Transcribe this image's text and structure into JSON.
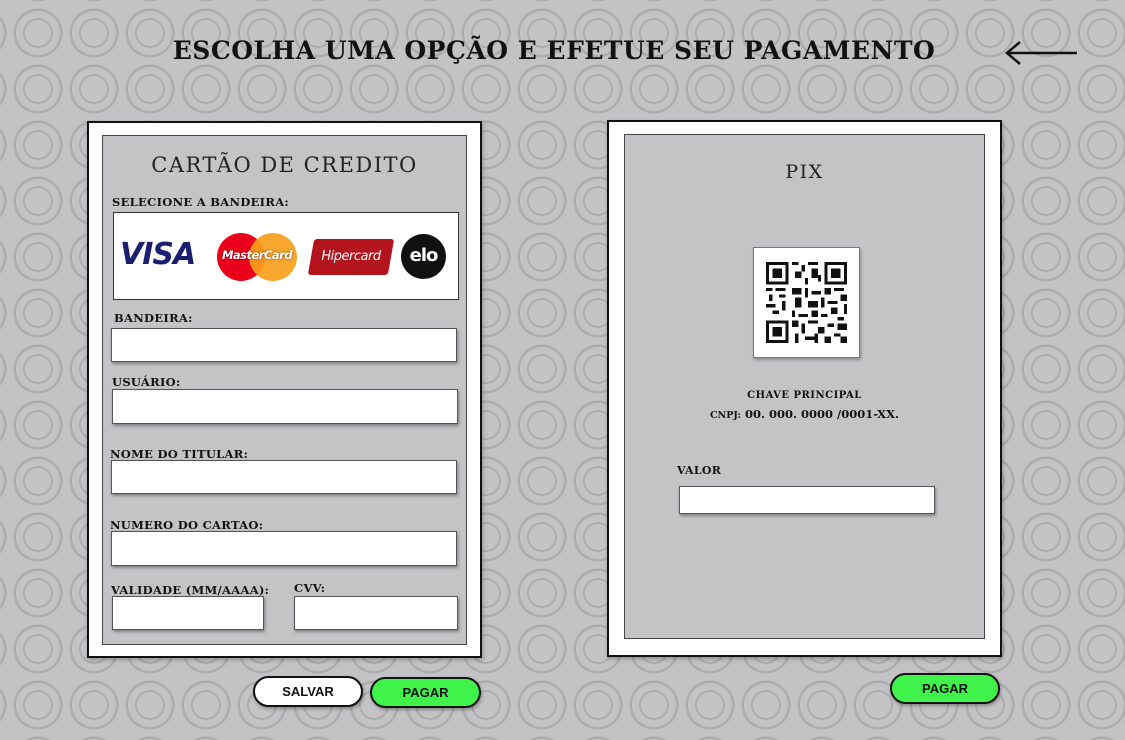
{
  "header": {
    "title": "ESCOLHA UMA OPÇÃO E EFETUE SEU PAGAMENTO",
    "back_icon": "arrow-left-icon"
  },
  "credit_card": {
    "title": "CARTÃO DE CREDITO",
    "select_brand_label": "SELECIONE A BANDEIRA:",
    "brands": [
      {
        "name": "VISA",
        "color": "#1a1f71"
      },
      {
        "name": "MasterCard",
        "color": "#eb001b"
      },
      {
        "name": "Hipercard",
        "color": "#b3131b"
      },
      {
        "name": "elo",
        "color": "#111111"
      }
    ],
    "fields": {
      "bandeira_label": "BANDEIRA:",
      "usuario_label": "USUÁRIO:",
      "nome_label": "NOME DO TITULAR:",
      "numero_label": "NUMERO DO CARTAO:",
      "validade_label": "VALIDADE (MM/AAAA):",
      "cvv_label": "CVV:"
    }
  },
  "pix": {
    "title": "PIX",
    "qr_icon": "qr-code-icon",
    "key_title": "CHAVE PRINCIPAL",
    "key_type": "CNPJ:",
    "key_value": "00. 000. 0000 /0001-XX.",
    "valor_label": "VALOR"
  },
  "buttons": {
    "salvar": "SALVAR",
    "pagar_card": "PAGAR",
    "pagar_pix": "PAGAR"
  },
  "colors": {
    "background": "#c3c3c5",
    "panel_inner": "#c4c4c6",
    "pay_button": "#3ff34a"
  }
}
